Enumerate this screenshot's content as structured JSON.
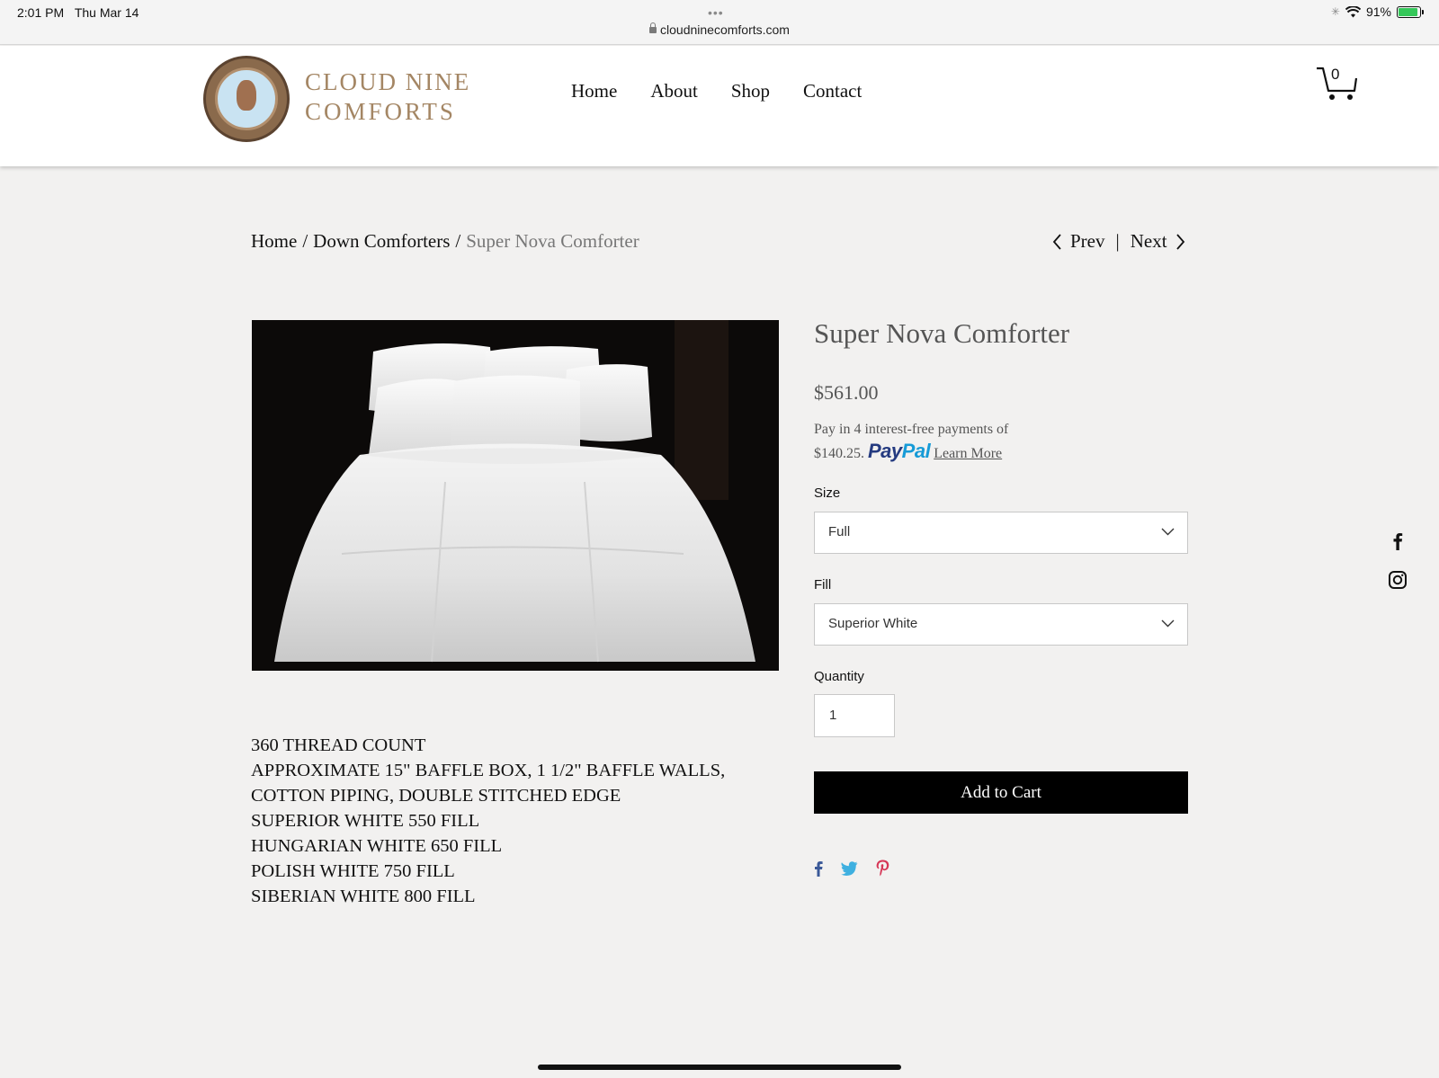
{
  "status_bar": {
    "time": "2:01 PM",
    "date": "Thu Mar 14",
    "url": "cloudninecomforts.com",
    "battery": "91%"
  },
  "header": {
    "logo_line1": "CLOUD NINE",
    "logo_line2": "COMFORTS",
    "nav": [
      "Home",
      "About",
      "Shop",
      "Contact"
    ],
    "cart_count": "0"
  },
  "breadcrumb": {
    "home": "Home",
    "category": "Down Comforters",
    "current": "Super Nova Comforter",
    "separator": "/"
  },
  "pager": {
    "prev": "Prev",
    "next": "Next",
    "divider": "|"
  },
  "product": {
    "title": "Super Nova Comforter",
    "price": "$561.00",
    "paypal_line1": "Pay in 4 interest-free payments of",
    "paypal_amount": "$140.25.",
    "paypal_logo_pay": "Pay",
    "paypal_logo_pal": "Pal",
    "learn_more": "Learn More",
    "size_label": "Size",
    "size_value": "Full",
    "fill_label": "Fill",
    "fill_value": "Superior White",
    "quantity_label": "Quantity",
    "quantity_value": "1",
    "add_to_cart": "Add to Cart"
  },
  "description": [
    "360 THREAD COUNT",
    "APPROXIMATE 15\" BAFFLE BOX, 1 1/2\" BAFFLE WALLS,",
    "COTTON PIPING, DOUBLE STITCHED EDGE",
    "SUPERIOR WHITE 550 FILL",
    "HUNGARIAN WHITE 650 FILL",
    "POLISH WHITE 750 FILL",
    "SIBERIAN WHITE 800 FILL"
  ],
  "colors": {
    "brand_gold": "#a48664",
    "paypal_dark": "#253b80",
    "paypal_light": "#179bd7",
    "twitter": "#3fb0e0",
    "pinterest": "#d63656",
    "facebook_share": "#3b5998"
  },
  "icons": {
    "cart": "cart-icon",
    "share": [
      "facebook-icon",
      "twitter-icon",
      "pinterest-icon"
    ],
    "social": [
      "facebook-icon",
      "instagram-icon"
    ]
  }
}
